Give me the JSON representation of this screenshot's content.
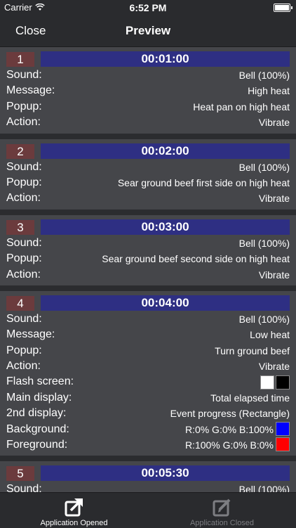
{
  "status_bar": {
    "carrier": "Carrier",
    "time": "6:52 PM"
  },
  "nav": {
    "close": "Close",
    "title": "Preview"
  },
  "events": [
    {
      "number": "1",
      "time": "00:01:00",
      "rows": [
        {
          "label": "Sound:",
          "value": "Bell (100%)"
        },
        {
          "label": "Message:",
          "value": "High heat"
        },
        {
          "label": "Popup:",
          "value": "Heat pan on high heat"
        },
        {
          "label": "Action:",
          "value": "Vibrate"
        }
      ]
    },
    {
      "number": "2",
      "time": "00:02:00",
      "rows": [
        {
          "label": "Sound:",
          "value": "Bell (100%)"
        },
        {
          "label": "Popup:",
          "value": "Sear ground beef first side on high heat"
        },
        {
          "label": "Action:",
          "value": "Vibrate"
        }
      ]
    },
    {
      "number": "3",
      "time": "00:03:00",
      "rows": [
        {
          "label": "Sound:",
          "value": "Bell (100%)"
        },
        {
          "label": "Popup:",
          "value": "Sear ground beef second side on high heat"
        },
        {
          "label": "Action:",
          "value": "Vibrate"
        }
      ]
    },
    {
      "number": "4",
      "time": "00:04:00",
      "rows": [
        {
          "label": "Sound:",
          "value": "Bell (100%)"
        },
        {
          "label": "Message:",
          "value": "Low heat"
        },
        {
          "label": "Popup:",
          "value": "Turn ground beef"
        },
        {
          "label": "Action:",
          "value": "Vibrate"
        },
        {
          "label": "Flash screen:",
          "value": "",
          "swatches": [
            "#ffffff",
            "#000000"
          ]
        },
        {
          "label": "Main display:",
          "value": "Total elapsed time"
        },
        {
          "label": "2nd display:",
          "value": "Event progress (Rectangle)"
        },
        {
          "label": "Background:",
          "value": "R:0% G:0% B:100%",
          "swatch": "#0000ff"
        },
        {
          "label": "Foreground:",
          "value": "R:100% G:0% B:0%",
          "swatch": "#ff0000"
        }
      ]
    },
    {
      "number": "5",
      "time": "00:05:30",
      "rows": [
        {
          "label": "Sound:",
          "value": "Bell (100%)"
        }
      ]
    }
  ],
  "tabbar": {
    "opened": {
      "label": "Application Opened",
      "icon": "open-external-icon"
    },
    "closed": {
      "label": "Application Closed",
      "icon": "edit-icon"
    }
  },
  "colors": {
    "time_bar": "#2e2f83",
    "number_badge": "#6b3b3d",
    "background": "#3a3b3e"
  }
}
